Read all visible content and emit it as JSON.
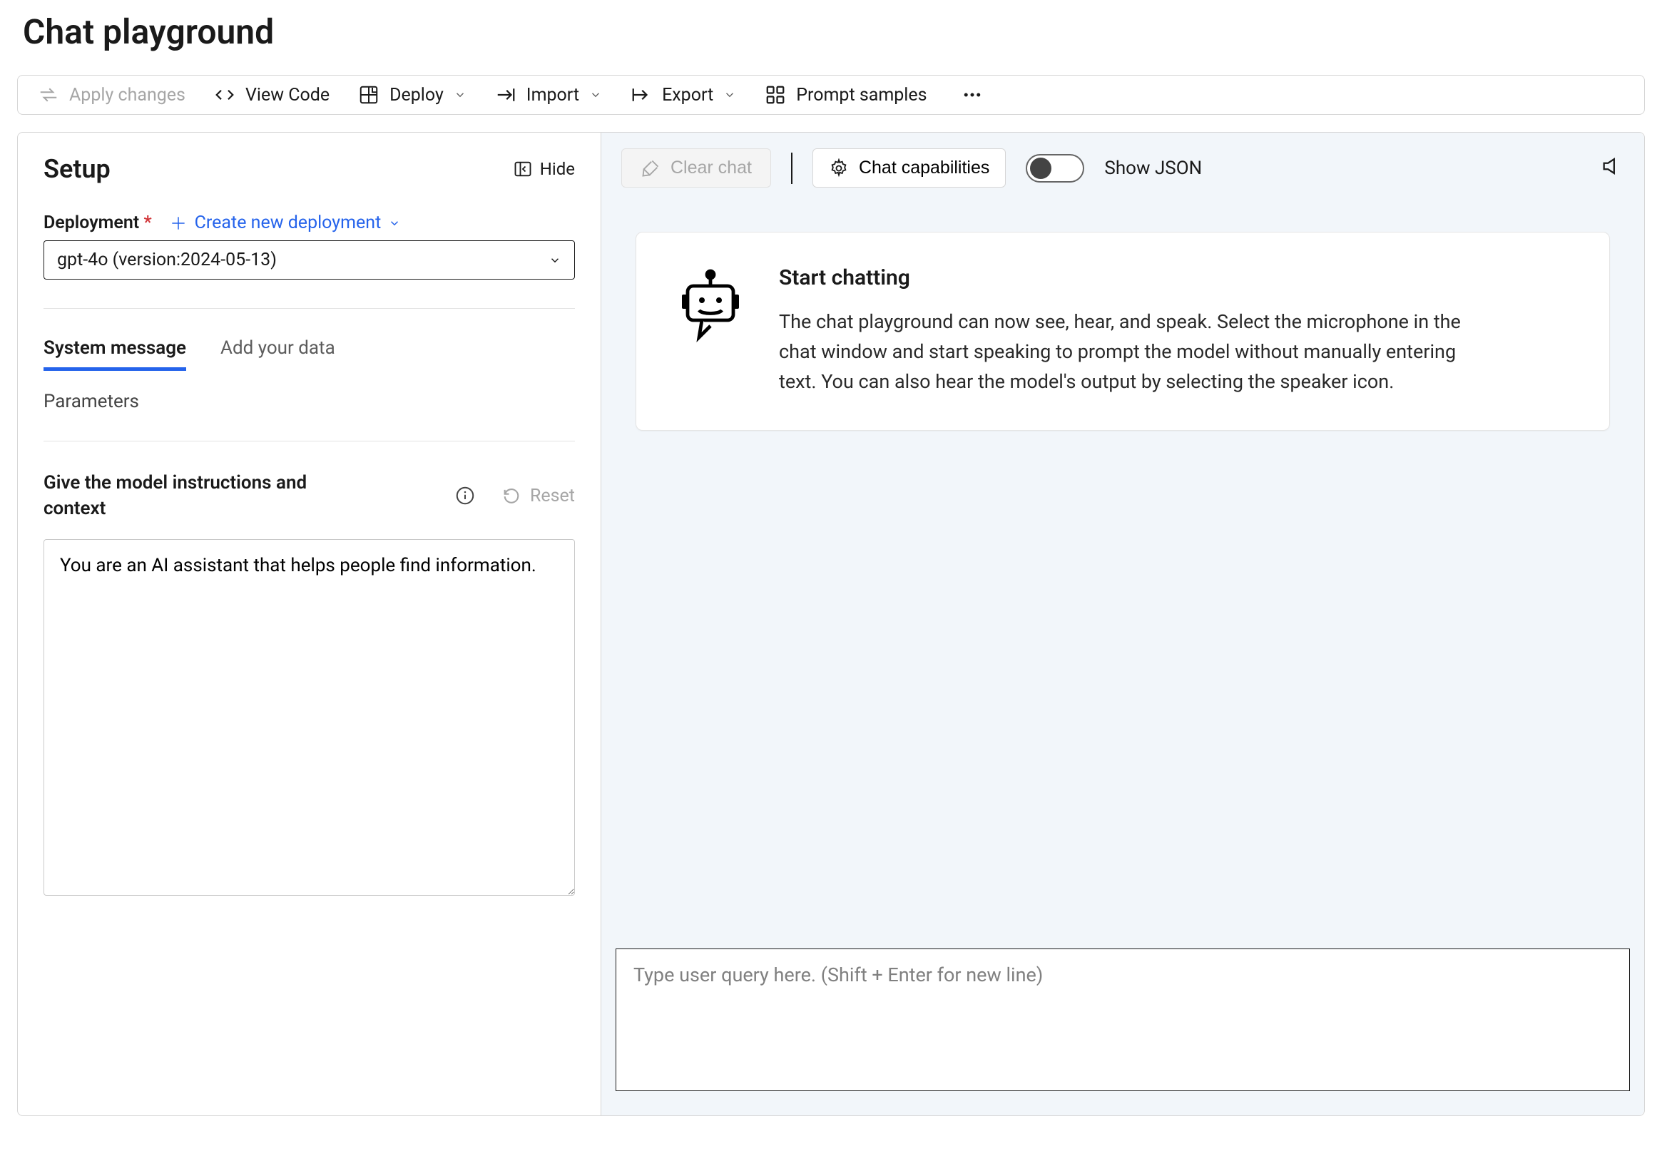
{
  "page": {
    "title": "Chat playground"
  },
  "toolbar": {
    "apply_changes": "Apply changes",
    "view_code": "View Code",
    "deploy": "Deploy",
    "import": "Import",
    "export": "Export",
    "prompt_samples": "Prompt samples"
  },
  "setup": {
    "heading": "Setup",
    "hide": "Hide",
    "deployment_label": "Deployment",
    "create_new": "Create new deployment",
    "deployment_value": "gpt-4o (version:2024-05-13)",
    "tabs": {
      "system_message": "System message",
      "add_data": "Add your data"
    },
    "parameters": "Parameters",
    "instructions_label": "Give the model instructions and context",
    "reset": "Reset",
    "system_message_value": "You are an AI assistant that helps people find information."
  },
  "chat": {
    "clear_chat": "Clear chat",
    "chat_capabilities": "Chat capabilities",
    "show_json": "Show JSON",
    "start_title": "Start chatting",
    "start_body": "The chat playground can now see, hear, and speak. Select the microphone in the chat window and start speaking to prompt the model without manually entering text. You can also hear the model's output by selecting the speaker icon.",
    "input_placeholder": "Type user query here. (Shift + Enter for new line)"
  }
}
